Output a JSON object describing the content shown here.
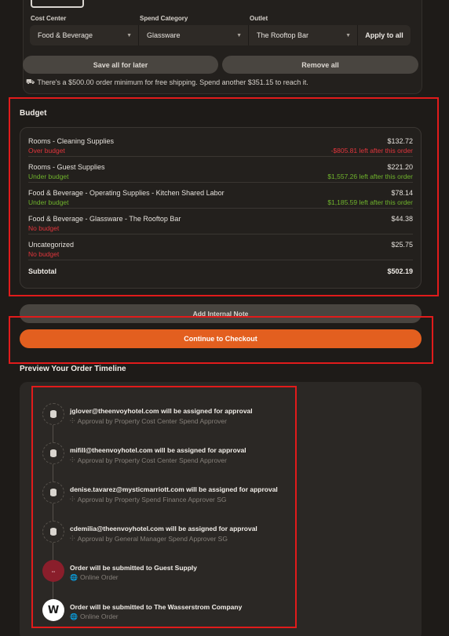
{
  "filters": {
    "cost_center": {
      "label": "Cost Center",
      "value": "Food & Beverage"
    },
    "spend_category": {
      "label": "Spend Category",
      "value": "Glassware"
    },
    "outlet": {
      "label": "Outlet",
      "value": "The Rooftop Bar"
    },
    "apply_all_label": "Apply to all"
  },
  "actions": {
    "save_all_label": "Save all for later",
    "remove_all_label": "Remove all"
  },
  "shipping_note": "There's a $500.00 order minimum for free shipping. Spend another $351.15 to reach it.",
  "budget": {
    "title": "Budget",
    "rows": [
      {
        "name": "Rooms - Cleaning Supplies",
        "status": "Over budget",
        "amount": "$132.72",
        "remaining": "-$805.81 left after this order"
      },
      {
        "name": "Rooms - Guest Supplies",
        "status": "Under budget",
        "amount": "$221.20",
        "remaining": "$1,557.26 left after this order"
      },
      {
        "name": "Food & Beverage - Operating Supplies - Kitchen Shared Labor",
        "status": "Under budget",
        "amount": "$78.14",
        "remaining": "$1,185.59 left after this order"
      },
      {
        "name": "Food & Beverage - Glassware - The Rooftop Bar",
        "status": "No budget",
        "amount": "$44.38",
        "remaining": ""
      },
      {
        "name": "Uncategorized",
        "status": "No budget",
        "amount": "$25.75",
        "remaining": ""
      }
    ],
    "subtotal_label": "Subtotal",
    "subtotal_value": "$502.19"
  },
  "internal_note_label": "Add Internal Note",
  "checkout_label": "Continue to Checkout",
  "timeline": {
    "title": "Preview Your Order Timeline",
    "items": [
      {
        "icon": "database-icon",
        "headline": "jglover@theenvoyhotel.com will be assigned for approval",
        "detail": "Approval by Property Cost Center Spend Approver"
      },
      {
        "icon": "database-icon",
        "headline": "mifill@theenvoyhotel.com will be assigned for approval",
        "detail": "Approval by Property Cost Center Spend Approver"
      },
      {
        "icon": "database-icon",
        "headline": "denise.tavarez@mysticmarriott.com will be assigned for approval",
        "detail": "Approval by Property Spend Finance Approver SG"
      },
      {
        "icon": "database-icon",
        "headline": "cdemilia@theenvoyhotel.com will be assigned for approval",
        "detail": "Approval by General Manager Spend Approver SG"
      },
      {
        "icon": "guest-supply-logo",
        "headline": "Order will be submitted to Guest Supply",
        "detail": "Online Order"
      },
      {
        "icon": "wasserstrom-logo",
        "headline": "Order will be submitted to The Wasserstrom Company",
        "detail": "Online Order"
      }
    ]
  },
  "colors": {
    "accent": "#e35f1f",
    "over_budget": "#e0353c",
    "under_budget": "#6fb32c",
    "highlight": "#e11b1b"
  }
}
